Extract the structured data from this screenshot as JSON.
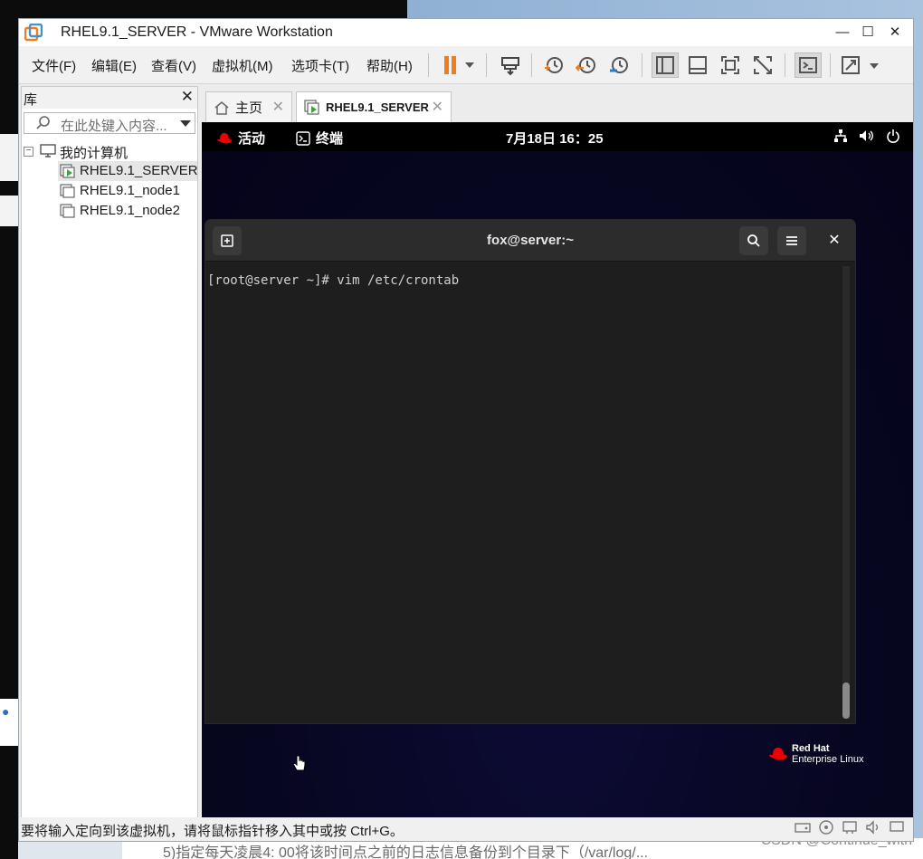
{
  "window": {
    "title": "RHEL9.1_SERVER - VMware Workstation"
  },
  "menu": {
    "items": [
      "文件(F)",
      "编辑(E)",
      "查看(V)",
      "虚拟机(M)",
      "选项卡(T)",
      "帮助(H)"
    ]
  },
  "library": {
    "title": "库",
    "search_placeholder": "在此处键入内容...",
    "root": "我的计算机",
    "vms": [
      "RHEL9.1_SERVER",
      "RHEL9.1_node1",
      "RHEL9.1_node2"
    ],
    "selected": "RHEL9.1_SERVER"
  },
  "tabs": [
    {
      "label": "主页",
      "icon": "home-icon",
      "active": false
    },
    {
      "label": "RHEL9.1_SERVER",
      "icon": "vm-running-icon",
      "active": true
    }
  ],
  "guest": {
    "topbar": {
      "activities": "活动",
      "app": "终端",
      "clock": "7月18日  16：25"
    },
    "terminal": {
      "title": "fox@server:~",
      "prompt": "[root@server ~]# vim /etc/crontab"
    },
    "branding": {
      "line1": "Red Hat",
      "line2": "Enterprise Linux"
    }
  },
  "statusbar": {
    "message": "要将输入定向到该虚拟机，请将鼠标指针移入其中或按 Ctrl+G。"
  },
  "background": {
    "text": "5)指定每天凌晨4: 00将该时间点之前的日志信息备份到个目录下（/var/log/...",
    "watermark": "CSDN @Continue_with"
  },
  "colors": {
    "accent_orange": "#f07d1a",
    "redhat_red": "#ee0000",
    "terminal_bg": "#1e1e1e"
  }
}
